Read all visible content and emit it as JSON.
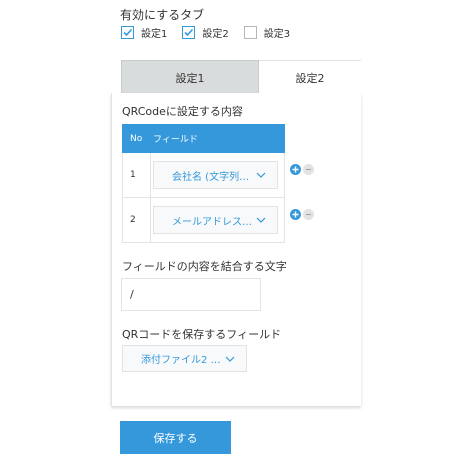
{
  "tab_toggles": {
    "title": "有効にするタブ",
    "items": [
      {
        "label": "設定1",
        "checked": true
      },
      {
        "label": "設定2",
        "checked": true
      },
      {
        "label": "設定3",
        "checked": false
      }
    ]
  },
  "tabs": [
    {
      "label": "設定1",
      "active": false
    },
    {
      "label": "設定2",
      "active": true
    }
  ],
  "panel": {
    "qrcode_section_label": "QRCodeに設定する内容",
    "table": {
      "headers": {
        "no": "No",
        "field": "フィールド"
      },
      "rows": [
        {
          "no": "1",
          "field": "会社名 (文字列…"
        },
        {
          "no": "2",
          "field": "メールアドレス…"
        }
      ]
    },
    "separator_label": "フィールドの内容を結合する文字",
    "separator_value": "/",
    "save_field_label": "QRコードを保存するフィールド",
    "save_field_value": "添付ファイル2 …"
  },
  "footer": {
    "save_label": "保存する"
  },
  "colors": {
    "accent": "#3498db",
    "inactive_tab": "#d8dcdd",
    "border": "#e3e3e3"
  },
  "icons": {
    "add": "plus-circle-icon",
    "remove": "minus-circle-icon",
    "dropdown": "chevron-down-icon",
    "check": "check-icon"
  }
}
